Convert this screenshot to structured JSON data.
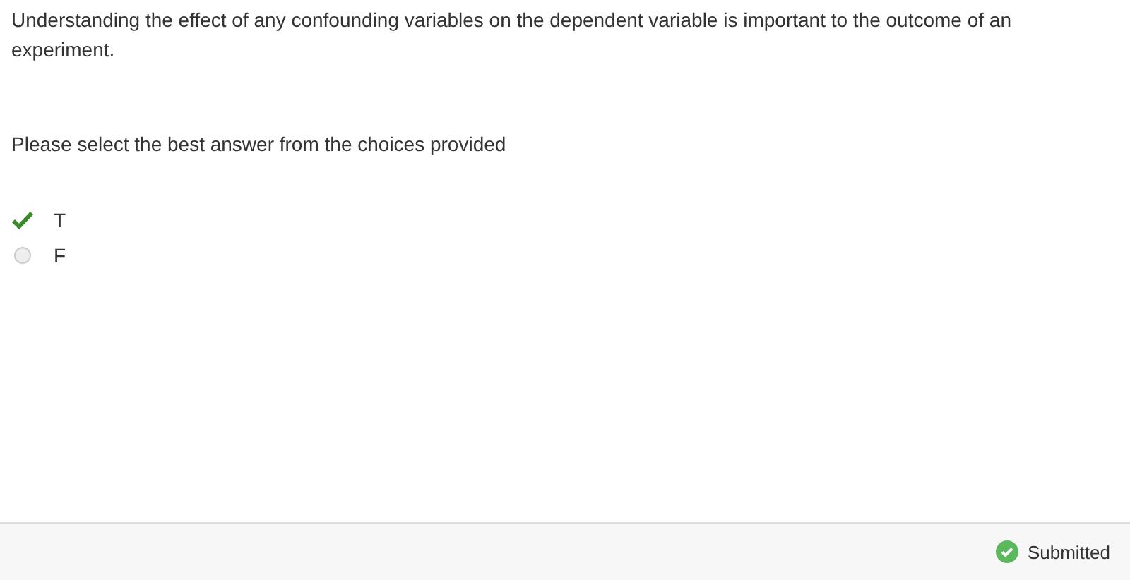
{
  "question": "Understanding the effect of any confounding variables on the dependent variable is important to the outcome of an experiment.",
  "prompt": "Please select the best answer from the choices provided",
  "choices": [
    {
      "label": "T",
      "selected": true
    },
    {
      "label": "F",
      "selected": false
    }
  ],
  "status_bar": {
    "status": "Submitted"
  }
}
